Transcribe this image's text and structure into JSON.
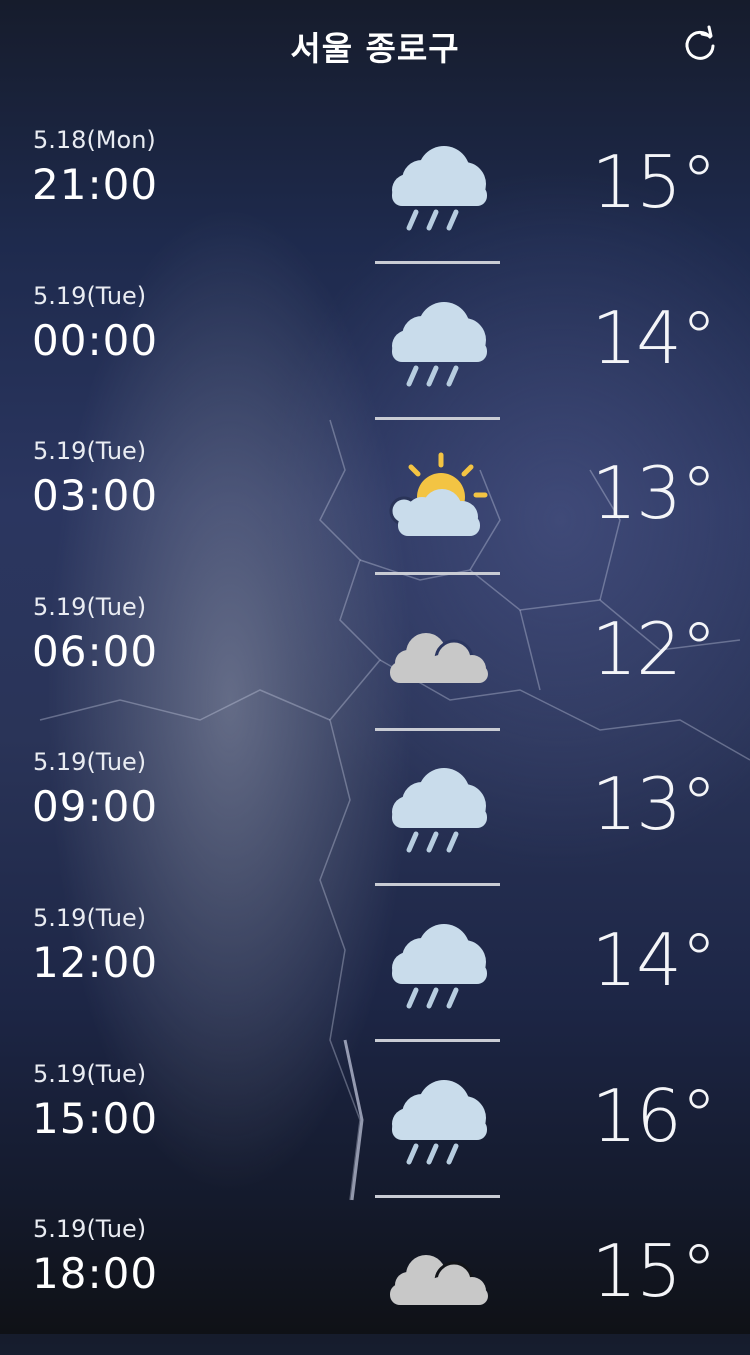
{
  "header": {
    "title": "서울 종로구",
    "refresh_icon": "refresh-icon"
  },
  "forecast": [
    {
      "date": "5.18(Mon)",
      "time": "21:00",
      "temp": "15°",
      "icon": "rain-icon"
    },
    {
      "date": "5.19(Tue)",
      "time": "00:00",
      "temp": "14°",
      "icon": "rain-icon"
    },
    {
      "date": "5.19(Tue)",
      "time": "03:00",
      "temp": "13°",
      "icon": "partly-sunny-icon"
    },
    {
      "date": "5.19(Tue)",
      "time": "06:00",
      "temp": "12°",
      "icon": "cloudy-icon"
    },
    {
      "date": "5.19(Tue)",
      "time": "09:00",
      "temp": "13°",
      "icon": "rain-icon"
    },
    {
      "date": "5.19(Tue)",
      "time": "12:00",
      "temp": "14°",
      "icon": "rain-icon"
    },
    {
      "date": "5.19(Tue)",
      "time": "15:00",
      "temp": "16°",
      "icon": "rain-icon"
    },
    {
      "date": "5.19(Tue)",
      "time": "18:00",
      "temp": "15°",
      "icon": "cloudy-icon"
    }
  ],
  "colors": {
    "rain_cloud": "#c9dceb",
    "rain_drop": "#b7cde0",
    "grey_cloud": "#c8c8c8",
    "sun": "#f3c443"
  }
}
